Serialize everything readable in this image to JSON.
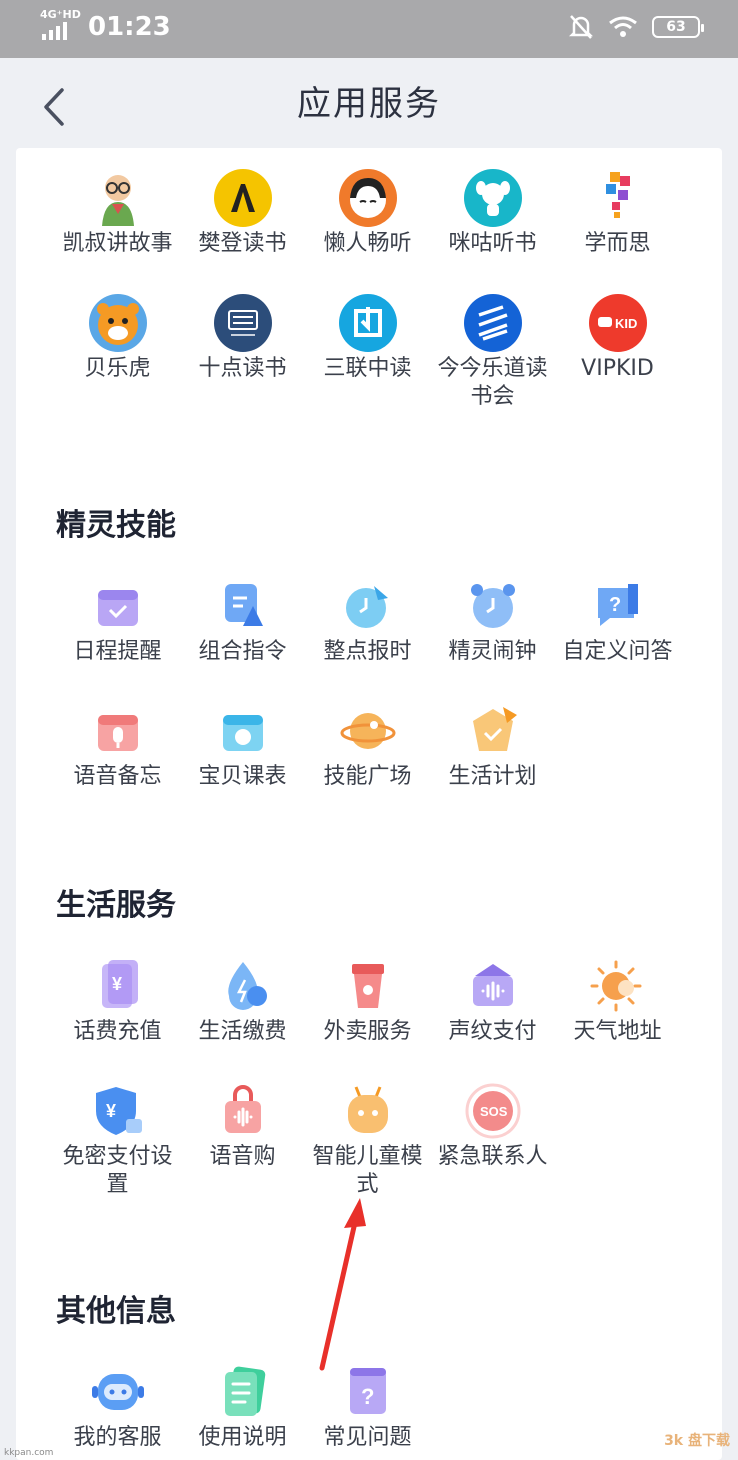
{
  "status_bar": {
    "network": "4G⁺HD",
    "time": "01:23",
    "battery": "63"
  },
  "header": {
    "title": "应用服务"
  },
  "apps": [
    {
      "label": "凯叔讲故事",
      "icon": "kaishu-icon"
    },
    {
      "label": "樊登读书",
      "icon": "fandeng-icon"
    },
    {
      "label": "懒人畅听",
      "icon": "lanren-icon"
    },
    {
      "label": "咪咕听书",
      "icon": "migu-icon"
    },
    {
      "label": "学而思",
      "icon": "xueersi-icon"
    },
    {
      "label": "贝乐虎",
      "icon": "beilehu-icon"
    },
    {
      "label": "十点读书",
      "icon": "shidian-icon"
    },
    {
      "label": "三联中读",
      "icon": "sanlian-icon"
    },
    {
      "label": "今今乐道读书会",
      "icon": "jinjin-icon"
    },
    {
      "label": "VIPKID",
      "icon": "vipkid-icon"
    }
  ],
  "sections": {
    "skills": {
      "title": "精灵技能",
      "items": [
        {
          "label": "日程提醒",
          "icon": "calendar-icon"
        },
        {
          "label": "组合指令",
          "icon": "command-icon"
        },
        {
          "label": "整点报时",
          "icon": "clock-icon"
        },
        {
          "label": "精灵闹钟",
          "icon": "alarm-icon"
        },
        {
          "label": "自定义问答",
          "icon": "qa-icon"
        },
        {
          "label": "语音备忘",
          "icon": "voice-memo-icon"
        },
        {
          "label": "宝贝课表",
          "icon": "schedule-icon"
        },
        {
          "label": "技能广场",
          "icon": "planet-icon"
        },
        {
          "label": "生活计划",
          "icon": "plan-icon"
        }
      ]
    },
    "life": {
      "title": "生活服务",
      "items": [
        {
          "label": "话费充值",
          "icon": "recharge-icon"
        },
        {
          "label": "生活缴费",
          "icon": "utility-icon"
        },
        {
          "label": "外卖服务",
          "icon": "takeout-icon"
        },
        {
          "label": "声纹支付",
          "icon": "voiceprint-icon"
        },
        {
          "label": "天气地址",
          "icon": "weather-icon"
        },
        {
          "label": "免密支付设置",
          "icon": "shield-pay-icon"
        },
        {
          "label": "语音购",
          "icon": "voice-shop-icon"
        },
        {
          "label": "智能儿童模式",
          "icon": "kid-robot-icon"
        },
        {
          "label": "紧急联系人",
          "icon": "sos-icon"
        }
      ]
    },
    "other": {
      "title": "其他信息",
      "items": [
        {
          "label": "我的客服",
          "icon": "service-robot-icon"
        },
        {
          "label": "使用说明",
          "icon": "manual-icon"
        },
        {
          "label": "常见问题",
          "icon": "faq-icon"
        }
      ]
    }
  },
  "watermark_left": "kkpan.com",
  "watermark_right": "3k 盘下载",
  "colors": {
    "background": "#eef0f4",
    "card": "#ffffff",
    "arrow": "#e8302a"
  }
}
